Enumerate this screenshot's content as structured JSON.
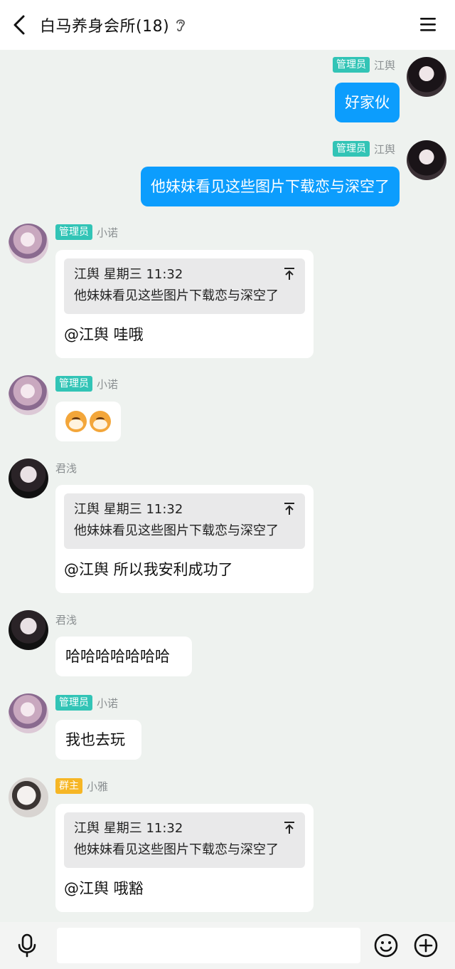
{
  "header": {
    "title": "白马养身会所(18)",
    "accent": "#0c9dfd"
  },
  "messages": [
    {
      "sender": "江舆",
      "role": "管理员",
      "text": "好家伙"
    },
    {
      "sender": "江舆",
      "role": "管理员",
      "text": "他妹妹看见这些图片下载恋与深空了"
    },
    {
      "sender": "小诺",
      "role": "管理员",
      "quote": {
        "author": "江舆",
        "time": "星期三 11:32",
        "text": "他妹妹看见这些图片下载恋与深空了"
      },
      "text": "@江舆 哇哦"
    },
    {
      "sender": "小诺",
      "role": "管理员",
      "emoji": [
        "dog-face-emoji",
        "dog-face-emoji"
      ]
    },
    {
      "sender": "君浅",
      "quote": {
        "author": "江舆",
        "time": "星期三 11:32",
        "text": "他妹妹看见这些图片下载恋与深空了"
      },
      "text": "@江舆 所以我安利成功了"
    },
    {
      "sender": "君浅",
      "text": "哈哈哈哈哈哈哈"
    },
    {
      "sender": "小诺",
      "role": "管理员",
      "text": "我也去玩"
    },
    {
      "sender": "小雅",
      "role": "群主",
      "quote": {
        "author": "江舆",
        "time": "星期三 11:32",
        "text": "他妹妹看见这些图片下载恋与深空了"
      },
      "text": "@江舆 哦豁"
    }
  ],
  "colors": {
    "admin_badge": "#32c4b6",
    "owner_badge": "#f6b625",
    "outgoing_bubble": "#0c9dfd",
    "background": "#eef2ef"
  }
}
